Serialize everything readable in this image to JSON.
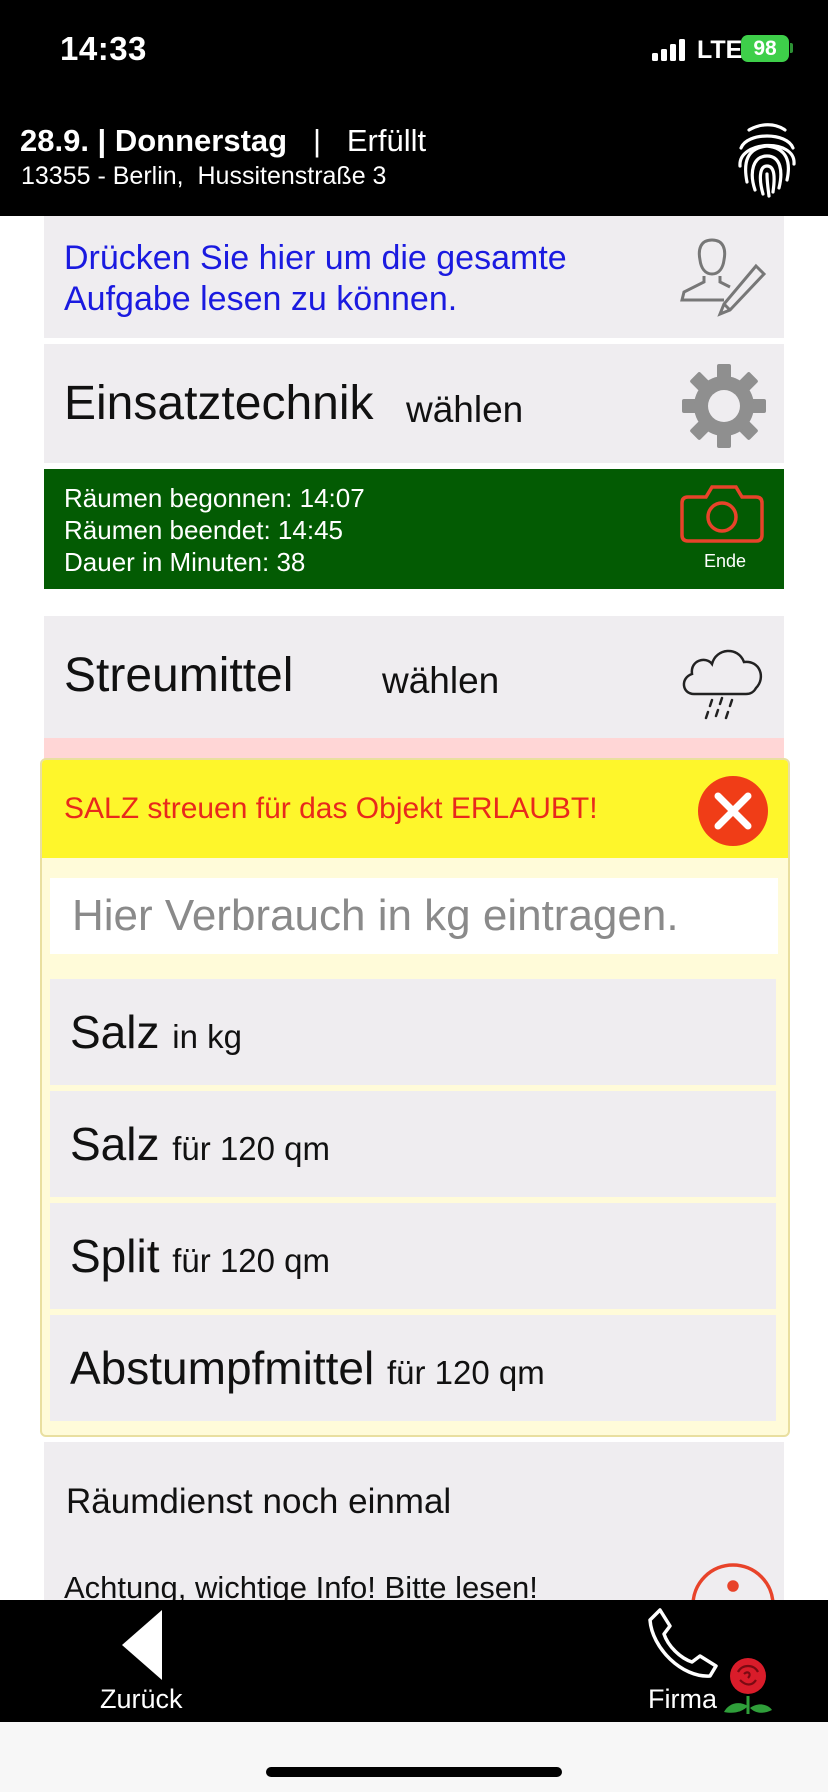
{
  "status_bar": {
    "time": "14:33",
    "network": "LTE",
    "battery": "98"
  },
  "header": {
    "date_day": "28.9. | Donnerstag",
    "separator": "|",
    "status": "Erfüllt",
    "address": "13355 - Berlin,  Hussitenstraße 3",
    "icon": "fingerprint-icon"
  },
  "task_card": {
    "text": "Drücken Sie hier um die gesamte Aufgabe lesen zu können.",
    "icon": "user-edit-icon"
  },
  "tech_card": {
    "label": "Einsatztechnik",
    "action": "wählen",
    "icon": "gear-icon"
  },
  "clearing_card": {
    "line1": "Räumen begonnen: 14:07",
    "line2": "Räumen beendet: 14:45",
    "line3": "Dauer in Minuten: 38",
    "camera_label": "Ende",
    "icon": "camera-icon"
  },
  "spread_card": {
    "label": "Streumittel",
    "action": "wählen",
    "icon": "cloud-snow-icon"
  },
  "modal": {
    "title": "SALZ streuen für das Objekt ERLAUBT!",
    "input_placeholder": "Hier Verbrauch in kg eintragen.",
    "options": [
      {
        "main": "Salz",
        "sub": "in kg"
      },
      {
        "main": "Salz",
        "sub": "für 120 qm"
      },
      {
        "main": "Split",
        "sub": "für 120 qm"
      },
      {
        "main": "Abstumpfmittel",
        "sub": "für 120 qm"
      }
    ]
  },
  "again_card": {
    "label": "Räumdienst noch einmal"
  },
  "info_card": {
    "label": "Achtung, wichtige Info! Bitte lesen!"
  },
  "bottom_bar": {
    "back_label": "Zurück",
    "company_label": "Firma"
  },
  "colors": {
    "accent_blue": "#1a1ae0",
    "green_panel": "#035b03",
    "modal_yellow": "#fef62b",
    "alert_red": "#e8291c",
    "close_red": "#f03d17"
  }
}
